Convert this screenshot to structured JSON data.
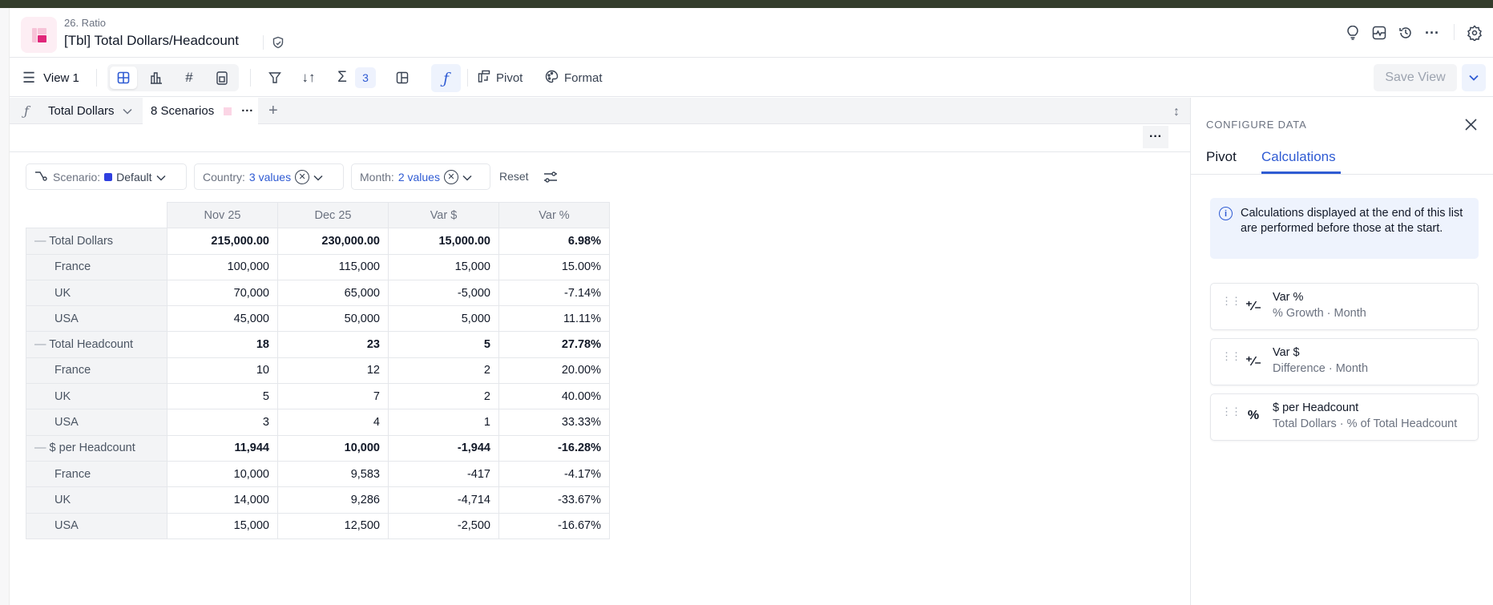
{
  "header": {
    "subtitle": "26. Ratio",
    "title": "[Tbl] Total Dollars/Headcount"
  },
  "toolbar": {
    "view_label": "View 1",
    "calc_count": "3",
    "pivot_label": "Pivot",
    "format_label": "Format",
    "save_label": "Save View"
  },
  "tabs": {
    "metric_label": "Total Dollars",
    "scenarios_label": "8 Scenarios"
  },
  "filters": {
    "scenario_label": "Scenario:",
    "scenario_value": "Default",
    "scenario_color": "#2f3fe0",
    "country_label": "Country:",
    "country_value": "3 values",
    "month_label": "Month:",
    "month_value": "2 values",
    "reset_label": "Reset"
  },
  "table": {
    "columns": [
      "Nov 25",
      "Dec 25",
      "Var $",
      "Var %"
    ],
    "rows": [
      {
        "label": "Total Dollars",
        "total": true,
        "values": [
          "215,000.00",
          "230,000.00",
          "15,000.00",
          "6.98%"
        ]
      },
      {
        "label": "France",
        "values": [
          "100,000",
          "115,000",
          "15,000",
          "15.00%"
        ]
      },
      {
        "label": "UK",
        "values": [
          "70,000",
          "65,000",
          "-5,000",
          "-7.14%"
        ]
      },
      {
        "label": "USA",
        "values": [
          "45,000",
          "50,000",
          "5,000",
          "11.11%"
        ]
      },
      {
        "label": "Total Headcount",
        "total": true,
        "values": [
          "18",
          "23",
          "5",
          "27.78%"
        ]
      },
      {
        "label": "France",
        "values": [
          "10",
          "12",
          "2",
          "20.00%"
        ]
      },
      {
        "label": "UK",
        "values": [
          "5",
          "7",
          "2",
          "40.00%"
        ]
      },
      {
        "label": "USA",
        "values": [
          "3",
          "4",
          "1",
          "33.33%"
        ]
      },
      {
        "label": "$ per Headcount",
        "total": true,
        "values": [
          "11,944",
          "10,000",
          "-1,944",
          "-16.28%"
        ]
      },
      {
        "label": "France",
        "values": [
          "10,000",
          "9,583",
          "-417",
          "-4.17%"
        ]
      },
      {
        "label": "UK",
        "values": [
          "14,000",
          "9,286",
          "-4,714",
          "-33.67%"
        ]
      },
      {
        "label": "USA",
        "values": [
          "15,000",
          "12,500",
          "-2,500",
          "-16.67%"
        ]
      }
    ]
  },
  "panel": {
    "heading": "CONFIGURE DATA",
    "tabs": [
      "Pivot",
      "Calculations"
    ],
    "info": "Calculations displayed at the end of this list are performed before those at the start.",
    "calculations": [
      {
        "name": "Var %",
        "desc": "% Growth · Month",
        "icon": "plus-minus-icon"
      },
      {
        "name": "Var $",
        "desc": "Difference · Month",
        "icon": "plus-minus-icon"
      },
      {
        "name": "$ per Headcount",
        "desc": "Total Dollars · % of Total Headcount",
        "icon": "percent-icon"
      }
    ]
  }
}
